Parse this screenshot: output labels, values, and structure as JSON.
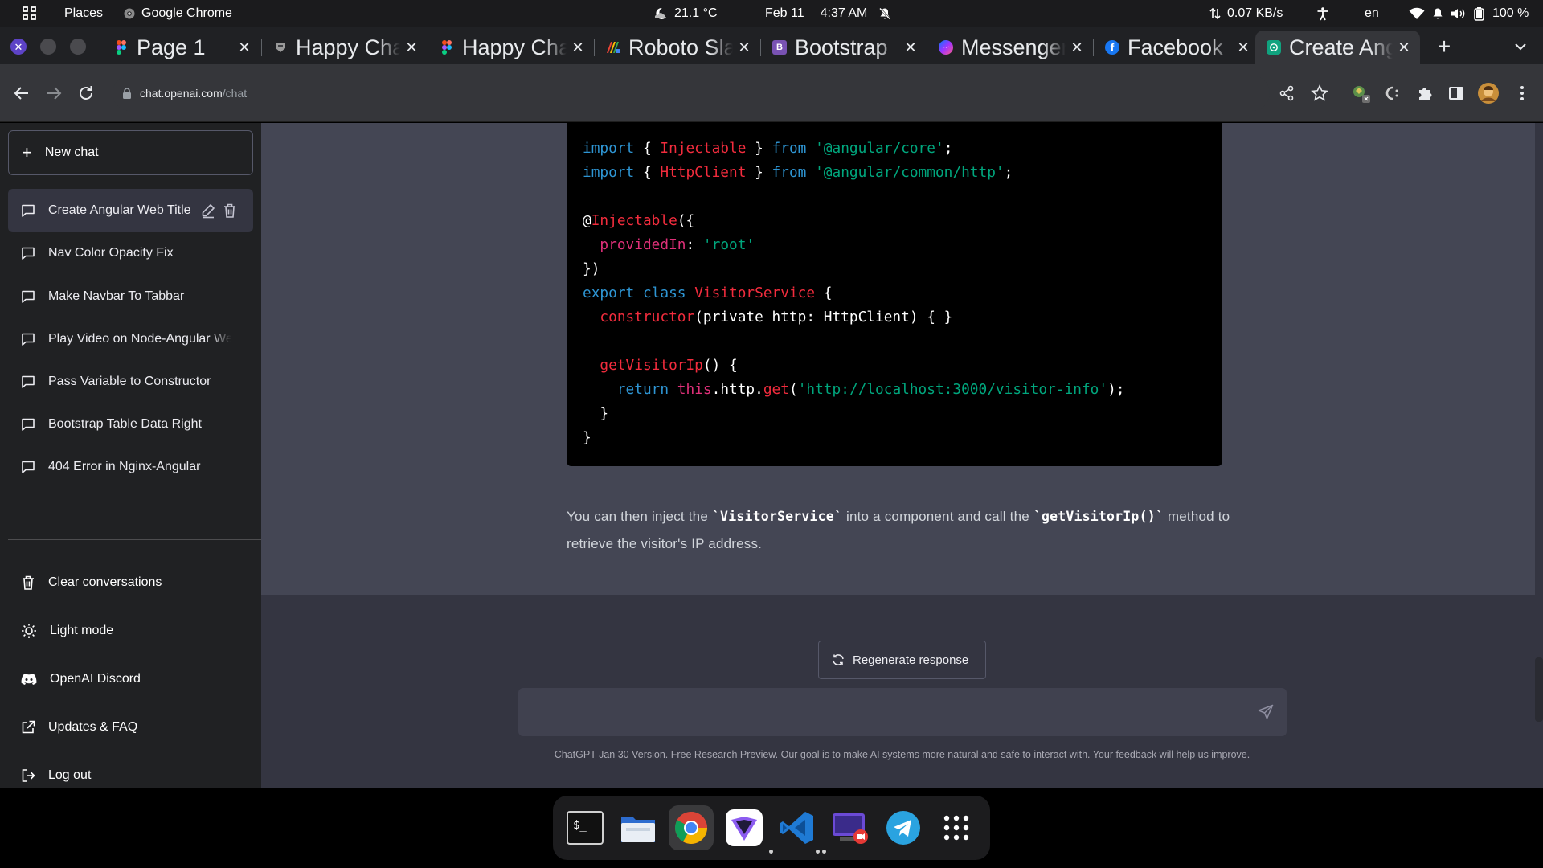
{
  "topbar": {
    "activities": "activities-grid-icon",
    "places": "Places",
    "app_name": "Google Chrome",
    "weather": "21.1 °C",
    "date": "Feb 11",
    "time": "4:37 AM",
    "network_speed": "0.07 KB/s",
    "language": "en",
    "battery": "100 %"
  },
  "tabs": [
    {
      "title": "Page 1",
      "icon": "figma-icon"
    },
    {
      "title": "Happy Chat",
      "icon": "happy-chat-icon"
    },
    {
      "title": "Happy Chat",
      "icon": "figma-icon"
    },
    {
      "title": "Roboto Slab",
      "icon": "google-fonts-icon"
    },
    {
      "title": "Bootstrap",
      "icon": "bootstrap-icon"
    },
    {
      "title": "Messenger",
      "icon": "messenger-icon"
    },
    {
      "title": "Facebook",
      "icon": "facebook-icon"
    },
    {
      "title": "Create Angular",
      "icon": "openai-icon",
      "active": true
    }
  ],
  "address": {
    "host": "chat.openai.com",
    "path": "/chat"
  },
  "sidebar": {
    "new_chat": "New chat",
    "conversations": [
      {
        "label": "Create Angular Web Title",
        "active": true
      },
      {
        "label": "Nav Color Opacity Fix"
      },
      {
        "label": "Make Navbar To Tabbar"
      },
      {
        "label": "Play Video on Node-Angular Web"
      },
      {
        "label": "Pass Variable to Constructor"
      },
      {
        "label": "Bootstrap Table Data Right"
      },
      {
        "label": "404 Error in Nginx-Angular"
      }
    ],
    "menu": [
      {
        "label": "Clear conversations",
        "icon": "trash-icon"
      },
      {
        "label": "Light mode",
        "icon": "sun-icon"
      },
      {
        "label": "OpenAI Discord",
        "icon": "discord-icon"
      },
      {
        "label": "Updates & FAQ",
        "icon": "external-link-icon"
      },
      {
        "label": "Log out",
        "icon": "logout-icon"
      }
    ]
  },
  "code": {
    "l1": {
      "a": "import",
      "b": " { ",
      "c": "Injectable",
      "d": " } ",
      "e": "from",
      "f": " ",
      "g": "'@angular/core'",
      "h": ";"
    },
    "l2": {
      "a": "import",
      "b": " { ",
      "c": "HttpClient",
      "d": " } ",
      "e": "from",
      "f": " ",
      "g": "'@angular/common/http'",
      "h": ";"
    },
    "l4": {
      "a": "@",
      "b": "Injectable",
      "c": "({"
    },
    "l5": {
      "a": "  ",
      "b": "providedIn",
      "c": ": ",
      "d": "'root'"
    },
    "l6": "})",
    "l7": {
      "a": "export",
      "b": " ",
      "c": "class",
      "d": " ",
      "e": "VisitorService",
      "f": " {"
    },
    "l8": {
      "a": "  ",
      "b": "constructor",
      "c": "(private http: HttpClient) { }"
    },
    "l10": {
      "a": "  ",
      "b": "getVisitorIp",
      "c": "() {"
    },
    "l11": {
      "a": "    ",
      "b": "return",
      "c": " ",
      "d": "this",
      "e": ".http.",
      "f": "get",
      "g": "(",
      "h": "'http://localhost:3000/visitor-info'",
      "i": ");"
    },
    "l12": "  }",
    "l13": "}"
  },
  "answer": {
    "p1": "You can then inject the ",
    "c1": "`VisitorService`",
    "p2": " into a component and call the ",
    "c2": "`getVisitorIp()`",
    "p3": " method to retrieve the visitor's IP address."
  },
  "regenerate": "Regenerate response",
  "composer": {
    "value": ""
  },
  "footer": {
    "version_link": "ChatGPT Jan 30 Version",
    "text": ". Free Research Preview. Our goal is to make AI systems more natural and safe to interact with. Your feedback will help us improve."
  },
  "dock": [
    {
      "name": "terminal-icon"
    },
    {
      "name": "files-icon"
    },
    {
      "name": "chrome-icon",
      "running": true
    },
    {
      "name": "proton-vpn-icon"
    },
    {
      "name": "vscode-icon",
      "running": true
    },
    {
      "name": "screen-recorder-icon"
    },
    {
      "name": "telegram-icon"
    },
    {
      "name": "app-grid-icon"
    }
  ],
  "colors": {
    "sidebar_bg": "#202123",
    "chat_bg": "#343541",
    "answer_bg": "#444654",
    "code_keyword": "#2e95d3",
    "code_type": "#f22c3d",
    "code_string": "#00a67d",
    "code_property": "#df3079"
  }
}
